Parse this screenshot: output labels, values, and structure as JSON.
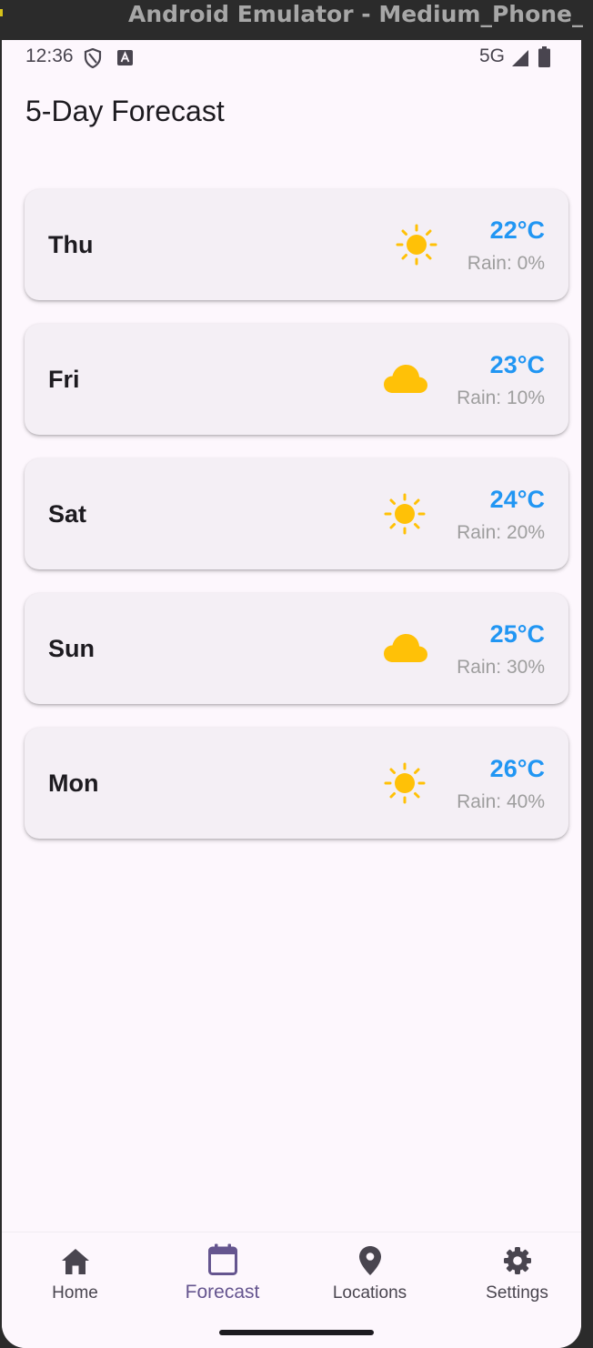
{
  "window": {
    "title": "Android Emulator - Medium_Phone_..."
  },
  "status_bar": {
    "time": "12:36",
    "network": "5G",
    "icons": [
      "shield-icon",
      "keyboard-a-icon",
      "signal-icon",
      "battery-icon"
    ]
  },
  "page": {
    "title": "5-Day Forecast"
  },
  "forecast": [
    {
      "day": "Thu",
      "temp": "22°C",
      "rain": "Rain: 0%",
      "icon": "sun-icon"
    },
    {
      "day": "Fri",
      "temp": "23°C",
      "rain": "Rain: 10%",
      "icon": "cloud-icon"
    },
    {
      "day": "Sat",
      "temp": "24°C",
      "rain": "Rain: 20%",
      "icon": "sun-icon"
    },
    {
      "day": "Sun",
      "temp": "25°C",
      "rain": "Rain: 30%",
      "icon": "cloud-icon"
    },
    {
      "day": "Mon",
      "temp": "26°C",
      "rain": "Rain: 40%",
      "icon": "sun-icon"
    }
  ],
  "nav": {
    "items": [
      {
        "label": "Home",
        "icon": "home-icon",
        "active": false
      },
      {
        "label": "Forecast",
        "icon": "calendar-icon",
        "active": true
      },
      {
        "label": "Locations",
        "icon": "location-pin-icon",
        "active": false
      },
      {
        "label": "Settings",
        "icon": "gear-icon",
        "active": false
      }
    ]
  },
  "colors": {
    "background": "#fdf7fd",
    "card": "#f4eff5",
    "temperature": "#2196f3",
    "weather_icon": "#ffc107",
    "nav_active": "#65558f",
    "nav_inactive": "#49454f"
  }
}
